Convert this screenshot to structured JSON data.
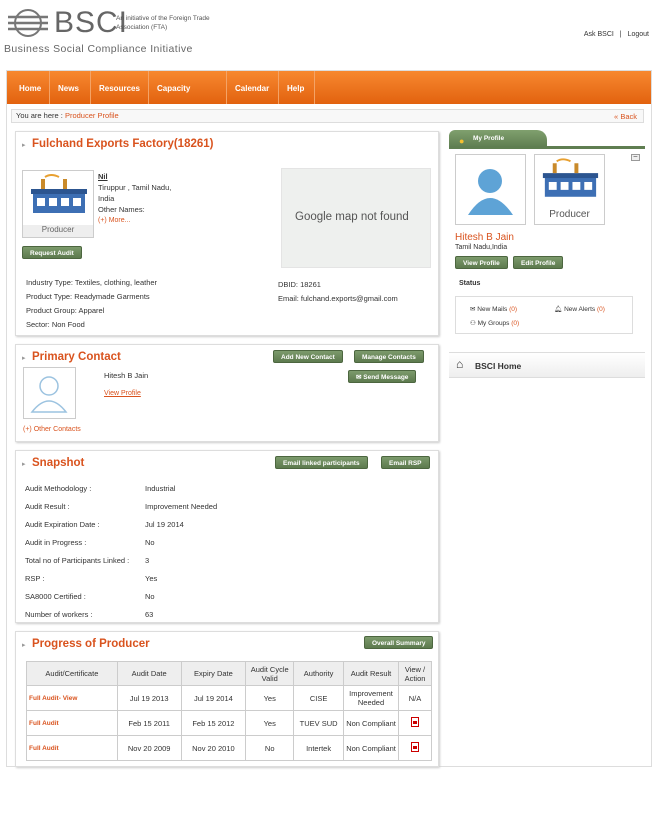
{
  "header": {
    "logo_text": "BSCI",
    "logo_sub": "An initiative of the Foreign Trade Association (FTA)",
    "tagline": "Business Social Compliance Initiative",
    "links": [
      "Ask BSCI",
      "|",
      "Logout"
    ]
  },
  "nav": [
    "Home",
    "News",
    "Resources",
    "Capacity Building",
    "Calendar",
    "Help"
  ],
  "breadcrumb": {
    "prefix": "You are here :",
    "current": "Producer Profile",
    "back": "Back"
  },
  "profile": {
    "title": "Fulchand Exports Factory(18261)",
    "producer_label": "Producer",
    "name_line": "Nil",
    "address": [
      "Tiruppur , Tamil Nadu,",
      "India"
    ],
    "other_names": "Other Names:",
    "more": "(+) More...",
    "request_audit": "Request Audit",
    "map_text": "Google map not found",
    "details_left": [
      "Industry Type: Textiles, clothing, leather",
      "Product Type: Readymade Garments",
      "Product Group: Apparel",
      "Sector: Non Food"
    ],
    "details_right": [
      "DBID: 18261",
      "Email: fulchand.exports@gmail.com"
    ]
  },
  "contact": {
    "title": "Primary Contact",
    "add": "Add New Contact",
    "manage": "Manage Contacts",
    "send": "Send Message",
    "name": "Hitesh B Jain",
    "view": "View Profile",
    "others": "(+) Other Contacts"
  },
  "snapshot": {
    "title": "Snapshot",
    "email_linked": "Email linked participants",
    "email_rsp": "Email RSP",
    "rows": [
      {
        "label": "Audit Methodology :",
        "value": "Industrial"
      },
      {
        "label": "Audit Result :",
        "value": "Improvement Needed"
      },
      {
        "label": "Audit Expiration Date :",
        "value": "Jul 19 2014"
      },
      {
        "label": "Audit in Progress :",
        "value": "No"
      },
      {
        "label": "Total no of Participants Linked :",
        "value": "3"
      },
      {
        "label": "RSP :",
        "value": "Yes"
      },
      {
        "label": "SA8000 Certified :",
        "value": "No"
      },
      {
        "label": "Number of workers :",
        "value": "63"
      }
    ]
  },
  "progress": {
    "title": "Progress of Producer",
    "summary": "Overall Summary",
    "headers": [
      "Audit/Certificate",
      "Audit Date",
      "Expiry Date",
      "Audit Cycle Valid",
      "Authority",
      "Audit Result",
      "View / Action"
    ],
    "rows": [
      [
        "Full Audit- View",
        "Jul 19 2013",
        "Jul 19 2014",
        "Yes",
        "CISE",
        "Improvement Needed",
        "N/A"
      ],
      [
        "Full Audit",
        "Feb 15 2011",
        "Feb 15 2012",
        "Yes",
        "TUEV SUD",
        "Non Compliant",
        ""
      ],
      [
        "Full Audit",
        "Nov 20 2009",
        "Nov 20 2010",
        "No",
        "Intertek",
        "Non Compliant",
        ""
      ]
    ]
  },
  "sidebar": {
    "tab": "My Profile",
    "producer_label": "Producer",
    "name": "Hitesh B Jain",
    "location": "Tamil Nadu,India",
    "view": "View Profile",
    "edit": "Edit Profile",
    "status": "Status",
    "mails": "New Mails",
    "mails_count": "(0)",
    "alerts": "New Alerts",
    "alerts_count": "(0)",
    "groups": "My Groups",
    "groups_count": "(0)",
    "home": "BSCI Home"
  }
}
